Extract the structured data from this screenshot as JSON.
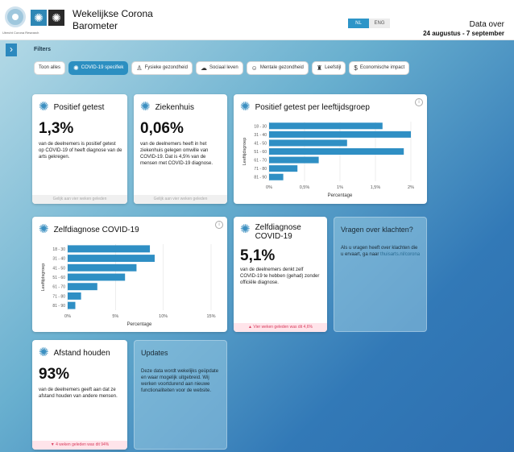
{
  "header": {
    "logo_text": "Utrecht Corona Research",
    "title": "Wekelijkse Corona Barometer",
    "lang_nl": "NL",
    "lang_eng": "ENG",
    "data_over": "Data over",
    "date_range": "24 augustus - 7 september"
  },
  "filters": {
    "label": "Filters",
    "items": [
      {
        "label": "Toon alles",
        "icon": "",
        "active": false
      },
      {
        "label": "COVID-19 specifiek",
        "icon": "virus-icon",
        "active": true
      },
      {
        "label": "Fysieke gezondheid",
        "icon": "body-icon",
        "active": false
      },
      {
        "label": "Sociaal leven",
        "icon": "chat-icon",
        "active": false
      },
      {
        "label": "Mentale gezondheid",
        "icon": "head-icon",
        "active": false
      },
      {
        "label": "Leefstijl",
        "icon": "drink-icon",
        "active": false
      },
      {
        "label": "Economische impact",
        "icon": "money-icon",
        "active": false
      }
    ]
  },
  "cards": {
    "positief": {
      "title": "Positief getest",
      "value": "1,3%",
      "desc": "van de deelnemers is positief getest op COVID-19 of heeft diagnose van de arts gekregen.",
      "footer": "Gelijk aan vier weken geleden"
    },
    "ziekenhuis": {
      "title": "Ziekenhuis",
      "value": "0,06%",
      "desc": "van de deelnemers heeft in het ziekenhuis gelegen omwille van COVID-19. Dat is 4,5% van de mensen met COVID-19 diagnose.",
      "footer": "Gelijk aan vier weken geleden"
    },
    "positief_leeftijd": {
      "title": "Positief getest per leeftijdsgroep"
    },
    "zelfdiagnose_chart": {
      "title": "Zelfdiagnose COVID-19"
    },
    "zelfdiagnose": {
      "title": "Zelfdiagnose COVID-19",
      "value": "5,1%",
      "desc": "van de deelnemers denkt zelf COVID-19 te hebben (gehad) zonder officiële diagnose.",
      "footer": "▲ Vier weken geleden was dit 4,6%"
    },
    "vragen": {
      "title": "Vragen over klachten?",
      "text": "Als u vragen heeft over klachten die u ervaart, ga naar",
      "link": "thuisarts.nl/corona"
    },
    "afstand": {
      "title": "Afstand houden",
      "value": "93%",
      "desc": "van de deelnemers geeft aan dat ze afstand houden van andere mensen.",
      "footer": "▼ 4 weken geleden was dit 94%"
    },
    "updates": {
      "title": "Updates",
      "text": "Deze data wordt wekelijks geüpdate en waar mogelijk uitgebreid. Wij werken voortdurend aan nieuwe functionaliteiten voor de website."
    }
  },
  "chart_data": [
    {
      "type": "bar",
      "title": "Positief getest per leeftijdsgroep",
      "orientation": "horizontal",
      "categories": [
        "18 - 30",
        "31 - 40",
        "41 - 50",
        "51 - 60",
        "61 - 70",
        "71 - 80",
        "81 - 90"
      ],
      "values": [
        1.6,
        2.0,
        1.1,
        1.9,
        0.7,
        0.4,
        0.2
      ],
      "xlabel": "Percentage",
      "ylabel": "Leeftijdsgroep",
      "xlim": [
        0,
        2.0
      ],
      "xticks": [
        "0%",
        "0,5%",
        "1%",
        "1,5%",
        "2%"
      ],
      "color": "#2f8fc4"
    },
    {
      "type": "bar",
      "title": "Zelfdiagnose COVID-19",
      "orientation": "horizontal",
      "categories": [
        "18 - 30",
        "31 - 40",
        "41 - 50",
        "51 - 60",
        "61 - 70",
        "71 - 80",
        "81 - 90"
      ],
      "values": [
        8.6,
        9.1,
        7.2,
        6.0,
        3.1,
        1.4,
        0.8
      ],
      "xlabel": "Percentage",
      "ylabel": "Leeftijdsgroep",
      "xlim": [
        0,
        15
      ],
      "xticks": [
        "0%",
        "5%",
        "10%",
        "15%"
      ],
      "color": "#2f8fc4"
    }
  ]
}
